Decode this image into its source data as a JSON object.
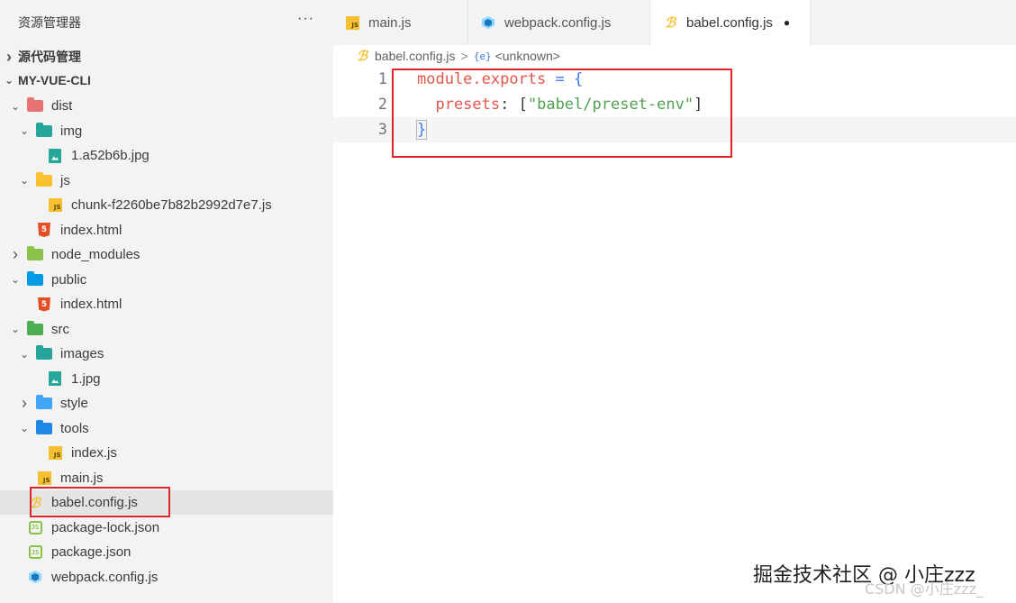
{
  "sidebar": {
    "title": "资源管理器",
    "more": "···",
    "sections": [
      {
        "label": "源代码管理",
        "expanded": false
      },
      {
        "label": "MY-VUE-CLI",
        "expanded": true
      }
    ],
    "tree": [
      {
        "label": "dist",
        "icon": "folder-dist-icon",
        "expanded": true,
        "folder_color": "#e57373",
        "depth": 1
      },
      {
        "label": "img",
        "icon": "folder-images-icon",
        "expanded": true,
        "folder_color": "#26a69a",
        "depth": 2
      },
      {
        "label": "1.a52b6b.jpg",
        "icon": "image-file-icon",
        "depth": 3
      },
      {
        "label": "js",
        "icon": "folder-js-icon",
        "expanded": true,
        "folder_color": "#fbc02d",
        "depth": 2
      },
      {
        "label": "chunk-f2260be7b82b2992d7e7.js",
        "icon": "js-file-icon",
        "depth": 3
      },
      {
        "label": "index.html",
        "icon": "html-file-icon",
        "depth": 2
      },
      {
        "label": "node_modules",
        "icon": "folder-node-icon",
        "expanded": false,
        "folder_color": "#8bc34a",
        "depth": 1
      },
      {
        "label": "public",
        "icon": "folder-public-icon",
        "expanded": true,
        "folder_color": "#039be5",
        "depth": 1
      },
      {
        "label": "index.html",
        "icon": "html-file-icon",
        "depth": 2
      },
      {
        "label": "src",
        "icon": "folder-src-icon",
        "expanded": true,
        "folder_color": "#4caf50",
        "depth": 1
      },
      {
        "label": "images",
        "icon": "folder-images-icon",
        "expanded": true,
        "folder_color": "#26a69a",
        "depth": 2
      },
      {
        "label": "1.jpg",
        "icon": "image-file-icon",
        "depth": 3
      },
      {
        "label": "style",
        "icon": "folder-style-icon",
        "expanded": false,
        "folder_color": "#42a5f5",
        "depth": 2
      },
      {
        "label": "tools",
        "icon": "folder-tools-icon",
        "expanded": true,
        "folder_color": "#1e88e5",
        "depth": 2
      },
      {
        "label": "index.js",
        "icon": "js-file-icon",
        "depth": 3
      },
      {
        "label": "main.js",
        "icon": "js-file-icon",
        "depth": 2
      },
      {
        "label": "babel.config.js",
        "icon": "babel-file-icon",
        "depth": 1,
        "selected": true
      },
      {
        "label": "package-lock.json",
        "icon": "json-file-icon",
        "depth": 1
      },
      {
        "label": "package.json",
        "icon": "json-file-icon",
        "depth": 1
      },
      {
        "label": "webpack.config.js",
        "icon": "webpack-file-icon",
        "depth": 1
      }
    ]
  },
  "tabs": [
    {
      "label": "main.js",
      "icon": "js-file-icon",
      "active": false
    },
    {
      "label": "webpack.config.js",
      "icon": "webpack-file-icon",
      "active": false
    },
    {
      "label": "babel.config.js",
      "icon": "babel-file-icon",
      "active": true,
      "dirty_marker": "●"
    }
  ],
  "breadcrumb": {
    "file": "babel.config.js",
    "separator": ">",
    "symbol_icon": "{e}",
    "symbol": "<unknown>"
  },
  "editor": {
    "lines": [
      {
        "number": "1",
        "tokens": [
          {
            "t": "module.exports",
            "c": "red"
          },
          {
            "t": " = ",
            "c": "blue"
          },
          {
            "t": "{",
            "c": "blue"
          }
        ]
      },
      {
        "number": "2",
        "tokens": [
          {
            "t": "  presets",
            "c": "red"
          },
          {
            "t": ": ",
            "c": "grey"
          },
          {
            "t": "[",
            "c": "grey"
          },
          {
            "t": "\"babel/preset-env\"",
            "c": "green"
          },
          {
            "t": "]",
            "c": "grey"
          }
        ]
      },
      {
        "number": "3",
        "tokens": [
          {
            "t": "}",
            "c": "blue"
          }
        ]
      }
    ],
    "current_line": 3
  },
  "watermark": "掘金技术社区 @ 小庄zzz",
  "watermark2": "CSDN @小庄zzz_",
  "colors": {
    "annotation": "#d9262a",
    "sidebar_bg": "#f3f3f3",
    "selected_bg": "#e4e4e4"
  }
}
